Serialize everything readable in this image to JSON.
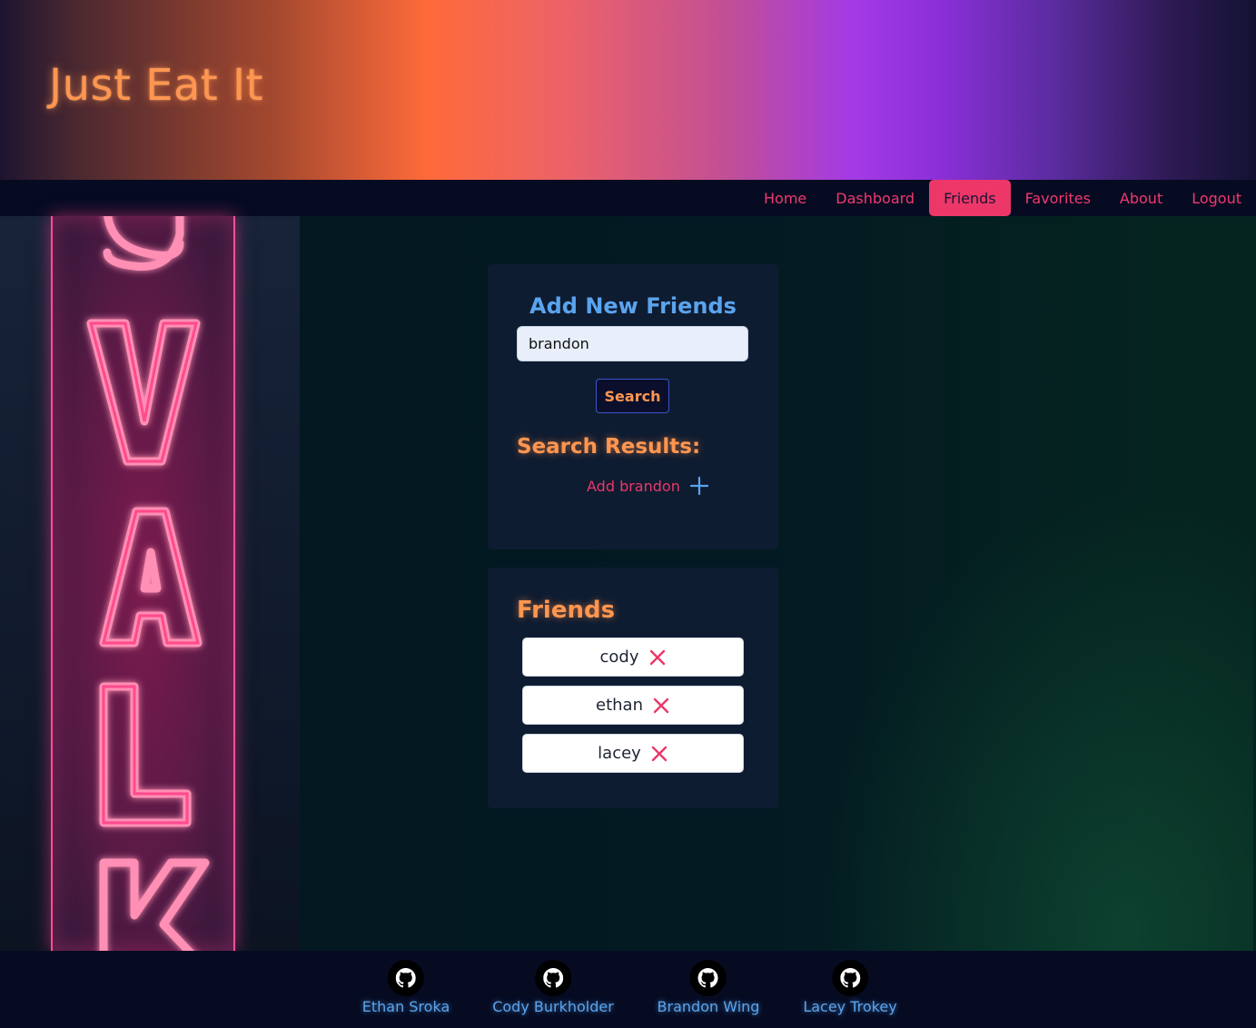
{
  "site": {
    "title": "Just Eat It"
  },
  "nav": {
    "items": [
      {
        "label": "Home",
        "active": false
      },
      {
        "label": "Dashboard",
        "active": false
      },
      {
        "label": "Friends",
        "active": true
      },
      {
        "label": "Favorites",
        "active": false
      },
      {
        "label": "About",
        "active": false
      },
      {
        "label": "Logout",
        "active": false
      }
    ]
  },
  "add_friends": {
    "title": "Add New Friends",
    "search_value": "brandon",
    "search_button": "Search",
    "results_title": "Search Results:",
    "result_label": "Add brandon",
    "result_icon": "plus-icon"
  },
  "friends": {
    "title": "Friends",
    "items": [
      {
        "name": "cody",
        "icon": "close-icon"
      },
      {
        "name": "ethan",
        "icon": "close-icon"
      },
      {
        "name": "lacey",
        "icon": "close-icon"
      }
    ]
  },
  "footer": {
    "authors": [
      {
        "name": "Ethan Sroka",
        "icon": "github-icon"
      },
      {
        "name": "Cody Burkholder",
        "icon": "github-icon"
      },
      {
        "name": "Brandon Wing",
        "icon": "github-icon"
      },
      {
        "name": "Lacey Trokey",
        "icon": "github-icon"
      }
    ]
  },
  "colors": {
    "accent_pink": "#ec3768",
    "accent_orange": "#ff9650",
    "accent_blue": "#5aa4ee",
    "panel_bg": "#0e1c31",
    "nav_bg": "#060b22"
  }
}
